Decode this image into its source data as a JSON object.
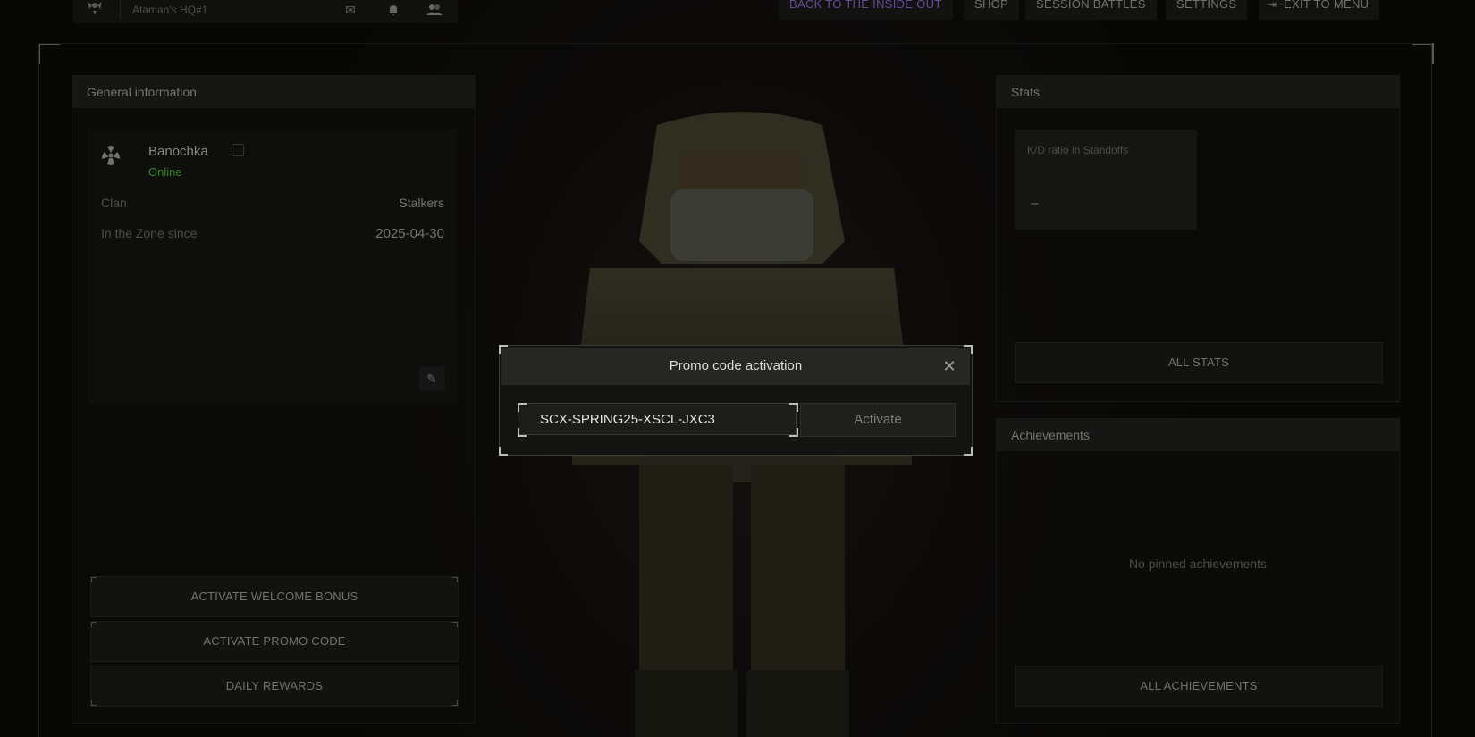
{
  "topbar": {
    "hq_name": "Ataman's HQ#1",
    "icons": [
      "mail-icon",
      "bell-icon",
      "friends-icon"
    ],
    "nav": {
      "back": "BACK TO THE INSIDE OUT",
      "shop": "SHOP",
      "session_battles": "SESSION BATTLES",
      "settings": "SETTINGS",
      "exit": "EXIT TO MENU"
    }
  },
  "general": {
    "title": "General information",
    "player_name": "Banochka",
    "status": "Online",
    "clan_label": "Clan",
    "clan_value": "Stalkers",
    "since_label": "In the Zone since",
    "since_value": "2025-04-30",
    "buttons": {
      "welcome_bonus": "ACTIVATE WELCOME BONUS",
      "promo_code": "ACTIVATE PROMO CODE",
      "daily_rewards": "DAILY REWARDS"
    }
  },
  "stats": {
    "title": "Stats",
    "kd_label": "K/D ratio in Standoffs",
    "kd_value": "–",
    "all_stats": "ALL STATS"
  },
  "achievements": {
    "title": "Achievements",
    "empty": "No pinned achievements",
    "all": "ALL ACHIEVEMENTS"
  },
  "modal": {
    "title": "Promo code activation",
    "promo_value": "SCX-SPRING25-XSCL-JXC3",
    "activate": "Activate"
  },
  "colors": {
    "online": "#3fa33a",
    "active_nav": "#7a5fb6"
  }
}
